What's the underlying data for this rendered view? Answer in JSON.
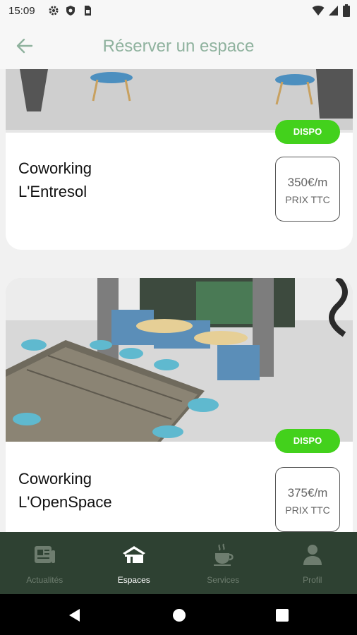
{
  "status_bar": {
    "time": "15:09",
    "left_icons": [
      "settings-icon",
      "shield-icon",
      "sim-card-icon"
    ],
    "right_icons": [
      "wifi-icon",
      "signal-icon",
      "battery-icon"
    ]
  },
  "app_bar": {
    "back_icon": "arrow-left-icon",
    "title": "Réserver un espace"
  },
  "spaces": [
    {
      "name_line1": "Coworking",
      "name_line2": "L'Entresol",
      "status": "DISPO",
      "price": "350€/m",
      "price_note": "PRIX TTC"
    },
    {
      "name_line1": "Coworking",
      "name_line2": "L'OpenSpace",
      "status": "DISPO",
      "price": "375€/m",
      "price_note": "PRIX TTC"
    }
  ],
  "bottom_nav": [
    {
      "label": "Actualités",
      "icon": "newspaper-icon",
      "active": false
    },
    {
      "label": "Espaces",
      "icon": "building-icon",
      "active": true
    },
    {
      "label": "Services",
      "icon": "coffee-cup-icon",
      "active": false
    },
    {
      "label": "Profil",
      "icon": "person-icon",
      "active": false
    }
  ],
  "colors": {
    "accent_title": "#8fb29e",
    "dispo_badge": "#43d11c",
    "nav_background": "#2e4132",
    "nav_inactive": "#6e7d6f",
    "nav_active": "#ffffff"
  }
}
